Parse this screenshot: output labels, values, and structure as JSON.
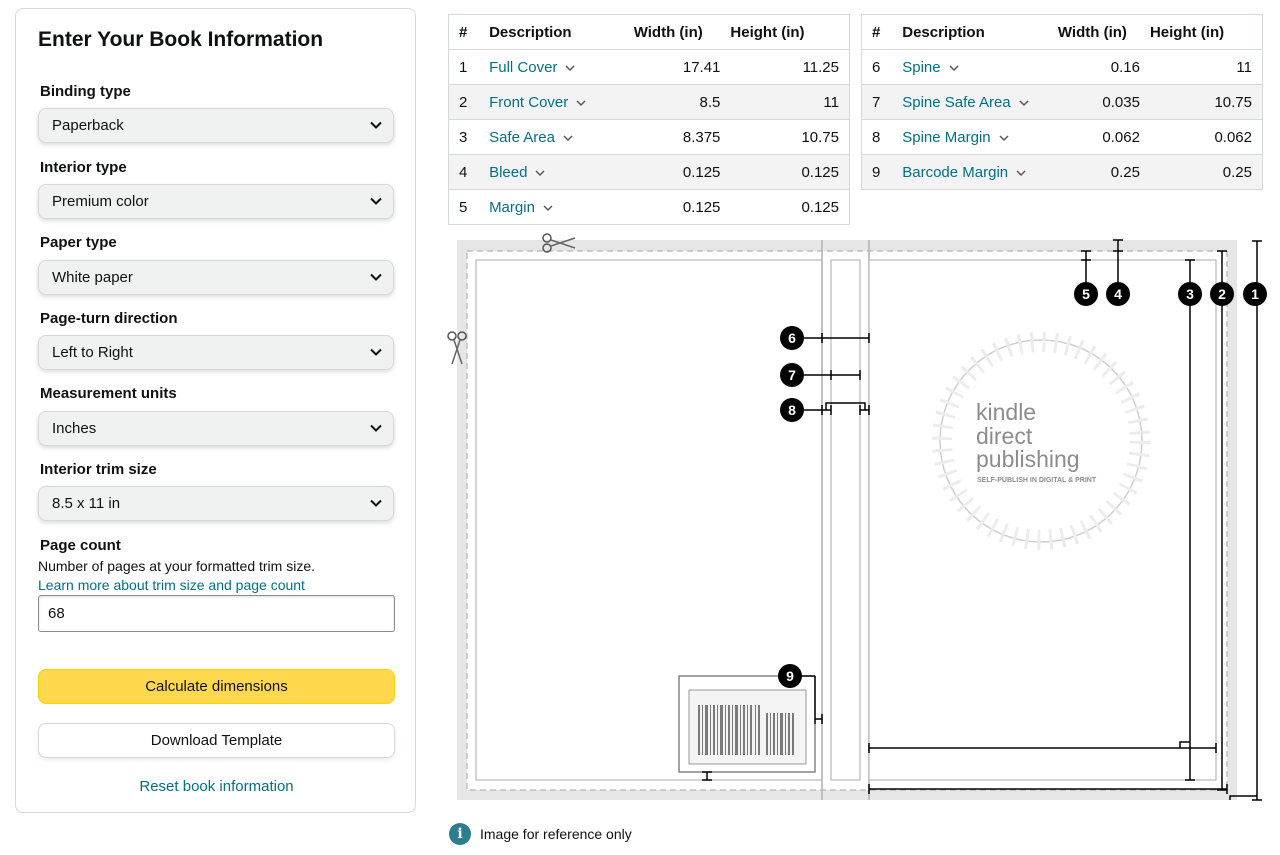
{
  "form": {
    "title": "Enter Your Book Information",
    "fields": [
      {
        "label": "Binding type",
        "value": "Paperback"
      },
      {
        "label": "Interior type",
        "value": "Premium color"
      },
      {
        "label": "Paper type",
        "value": "White paper"
      },
      {
        "label": "Page-turn direction",
        "value": "Left to Right"
      },
      {
        "label": "Measurement units",
        "value": "Inches"
      },
      {
        "label": "Interior trim size",
        "value": "8.5 x 11 in"
      }
    ],
    "page_count": {
      "label": "Page count",
      "help": "Number of pages at your formatted trim size.",
      "link": "Learn more about trim size and page count",
      "value": "68"
    },
    "calculate_label": "Calculate dimensions",
    "download_label": "Download Template",
    "reset_label": "Reset book information"
  },
  "table_headers": {
    "num": "#",
    "desc": "Description",
    "width": "Width (in)",
    "height": "Height (in)"
  },
  "table_left": [
    {
      "num": "1",
      "desc": "Full Cover",
      "width": "17.41",
      "height": "11.25"
    },
    {
      "num": "2",
      "desc": "Front Cover",
      "width": "8.5",
      "height": "11"
    },
    {
      "num": "3",
      "desc": "Safe Area",
      "width": "8.375",
      "height": "10.75"
    },
    {
      "num": "4",
      "desc": "Bleed",
      "width": "0.125",
      "height": "0.125"
    },
    {
      "num": "5",
      "desc": "Margin",
      "width": "0.125",
      "height": "0.125"
    }
  ],
  "table_right": [
    {
      "num": "6",
      "desc": "Spine",
      "width": "0.16",
      "height": "11"
    },
    {
      "num": "7",
      "desc": "Spine Safe Area",
      "width": "0.035",
      "height": "10.75"
    },
    {
      "num": "8",
      "desc": "Spine Margin",
      "width": "0.062",
      "height": "0.062"
    },
    {
      "num": "9",
      "desc": "Barcode Margin",
      "width": "0.25",
      "height": "0.25"
    }
  ],
  "diagram": {
    "logo_line1": "kindle",
    "logo_line2": "direct",
    "logo_line3": "publishing",
    "logo_tagline": "SELF-PUBLISH IN DIGITAL & PRINT",
    "markers": [
      "1",
      "2",
      "3",
      "4",
      "5",
      "6",
      "7",
      "8",
      "9"
    ]
  },
  "reference_note": "Image for reference only",
  "colors": {
    "accent_link": "#007185",
    "primary_button": "#ffd84d",
    "info_icon": "#2d7c8f"
  }
}
